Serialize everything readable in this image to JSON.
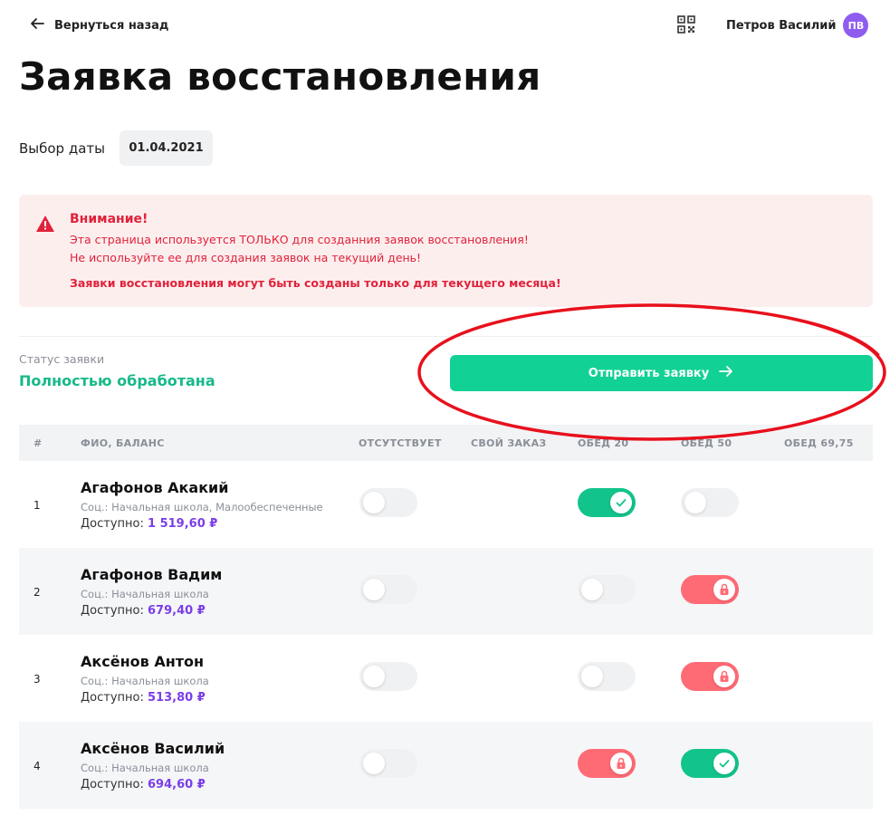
{
  "header": {
    "back_label": "Вернуться назад",
    "user_name": "Петров Василий",
    "avatar_initials": "ПВ"
  },
  "page_title": "Заявка восстановления",
  "date": {
    "label": "Выбор даты",
    "value": "01.04.2021"
  },
  "alert": {
    "title": "Внимание!",
    "line1": "Эта страница используется ТОЛЬКО для созданния заявок восстановления!",
    "line2": "Не используйте ее для создания заявок на текущий день!",
    "line3": "Заявки восстановления могут быть созданы только для текущего месяца!"
  },
  "status": {
    "caption": "Статус заявки",
    "value": "Полностью обработана"
  },
  "submit_label": "Отправить заявку",
  "table": {
    "headers": {
      "num": "#",
      "name": "ФИО, БАЛАНС",
      "absent": "ОТСУТСТВУЕТ",
      "own_order": "СВОЙ ЗАКАЗ",
      "lunch1": "ОБЕД 20",
      "lunch2": "ОБЕД 50",
      "lunch3": "ОБЕД 69,75"
    },
    "balance_label": "Доступно:",
    "rows": [
      {
        "num": "1",
        "name": "Агафонов Акакий",
        "soc": "Соц.: Начальная школа, Малообеспеченные",
        "balance": "1 519,60 ₽",
        "absent": "off",
        "lunch1": "on",
        "lunch2": "off",
        "lunch3": "none"
      },
      {
        "num": "2",
        "name": "Агафонов Вадим",
        "soc": "Соц.: Начальная школа",
        "balance": "679,40 ₽",
        "absent": "off",
        "lunch1": "off",
        "lunch2": "locked",
        "lunch3": "none"
      },
      {
        "num": "3",
        "name": "Аксёнов Антон",
        "soc": "Соц.: Начальная школа",
        "balance": "513,80 ₽",
        "absent": "off",
        "lunch1": "off",
        "lunch2": "locked",
        "lunch3": "none"
      },
      {
        "num": "4",
        "name": "Аксёнов Василий",
        "soc": "Соц.: Начальная школа",
        "balance": "694,60 ₽",
        "absent": "off",
        "lunch1": "locked",
        "lunch2": "on",
        "lunch3": "none"
      }
    ]
  },
  "colors": {
    "accent_green": "#12d194",
    "status_green": "#17b98a",
    "alert_red": "#e0223a",
    "lock_red": "#ff6b75",
    "balance_purple": "#7b3ee8",
    "avatar_purple": "#8f5cf0",
    "annotation_red": "#e8101c"
  }
}
